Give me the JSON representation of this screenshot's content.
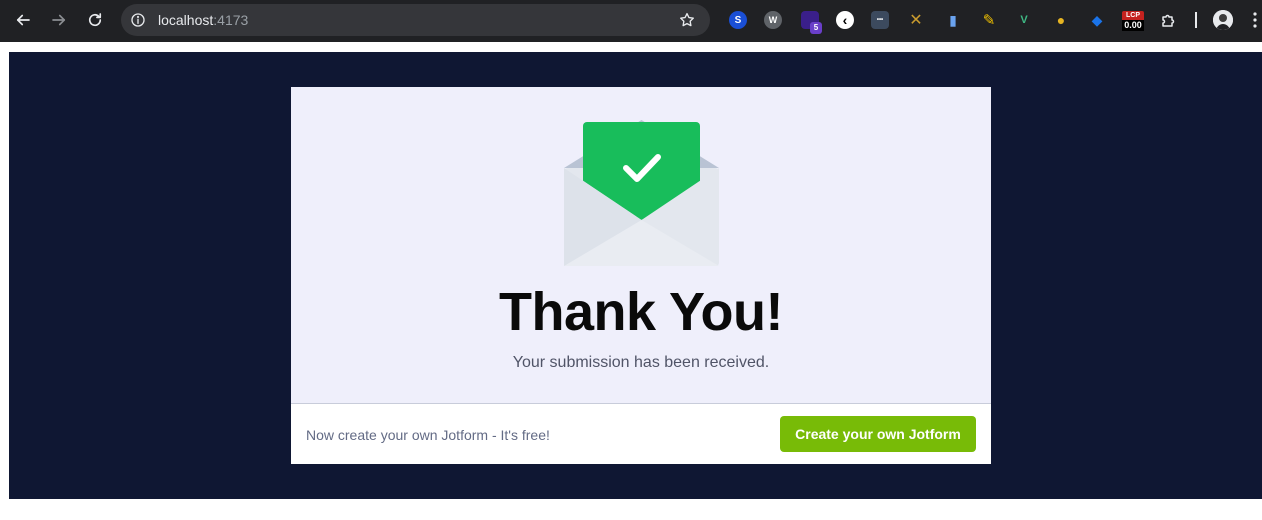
{
  "browser": {
    "url_host": "localhost",
    "url_port": ":4173",
    "extensions": [
      {
        "name": "s-extension-icon",
        "glyph": "S",
        "color": "#1a4fd6"
      },
      {
        "name": "w-extension-icon",
        "glyph": "W",
        "color": "#5f6368"
      },
      {
        "name": "stack-extension-icon",
        "glyph": "5",
        "color": "#6a3fc9"
      },
      {
        "name": "back-circle-extension-icon",
        "glyph": "‹",
        "color": "#ffffff"
      },
      {
        "name": "dots-extension-icon",
        "glyph": "•••",
        "color": "#3c4a5e"
      },
      {
        "name": "ruler-extension-icon",
        "glyph": "✕",
        "color": "#c99b2e"
      },
      {
        "name": "clipboard-extension-icon",
        "glyph": "▮",
        "color": "#6aa3f0"
      },
      {
        "name": "pen-extension-icon",
        "glyph": "✎",
        "color": "#f2c200"
      },
      {
        "name": "vue-extension-icon",
        "glyph": "V",
        "color": "#3fb984"
      },
      {
        "name": "duck-extension-icon",
        "glyph": "●",
        "color": "#e6b422"
      },
      {
        "name": "tag-extension-icon",
        "glyph": "◆",
        "color": "#1a73e8"
      }
    ],
    "lcp_label": "LCP",
    "lcp_value": "0.00"
  },
  "form": {
    "title": "Thank You!",
    "subtitle": "Your submission has been received.",
    "footer_text": "Now create your own Jotform - It's free!",
    "cta_label": "Create your own Jotform"
  },
  "colors": {
    "stage_bg": "#0f1733",
    "card_bg": "#efeffb",
    "cta_bg": "#78bb07",
    "envelope_flap": "#18bd5b"
  }
}
